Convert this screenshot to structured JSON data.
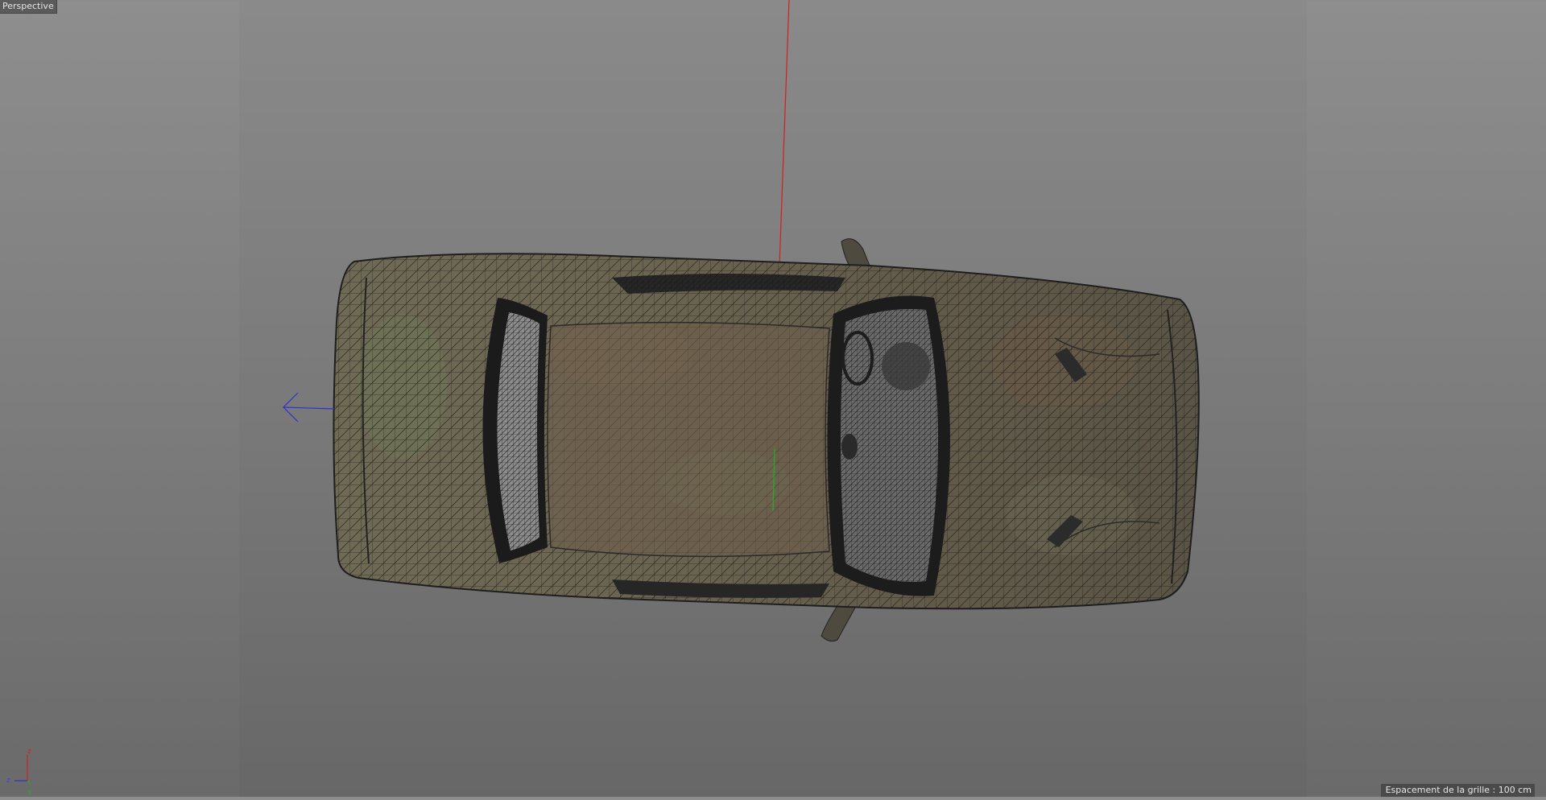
{
  "viewport": {
    "camera_label": "Perspective",
    "grid_spacing_text": "Espacement de la grille : 100 cm"
  },
  "axis_gizmo": {
    "x_label": "z",
    "y_label": "y",
    "z_label": "z"
  },
  "colors": {
    "background_top": "#8e8e8e",
    "background_bottom": "#6a6a6a",
    "axis_x": "#d02020",
    "axis_y": "#20b020",
    "axis_z": "#3030d0",
    "wireframe": "#1a1a1a",
    "body_base": "#6e6650"
  },
  "icons": [
    "axis-gizmo-icon",
    "z-axis-arrow-icon"
  ]
}
